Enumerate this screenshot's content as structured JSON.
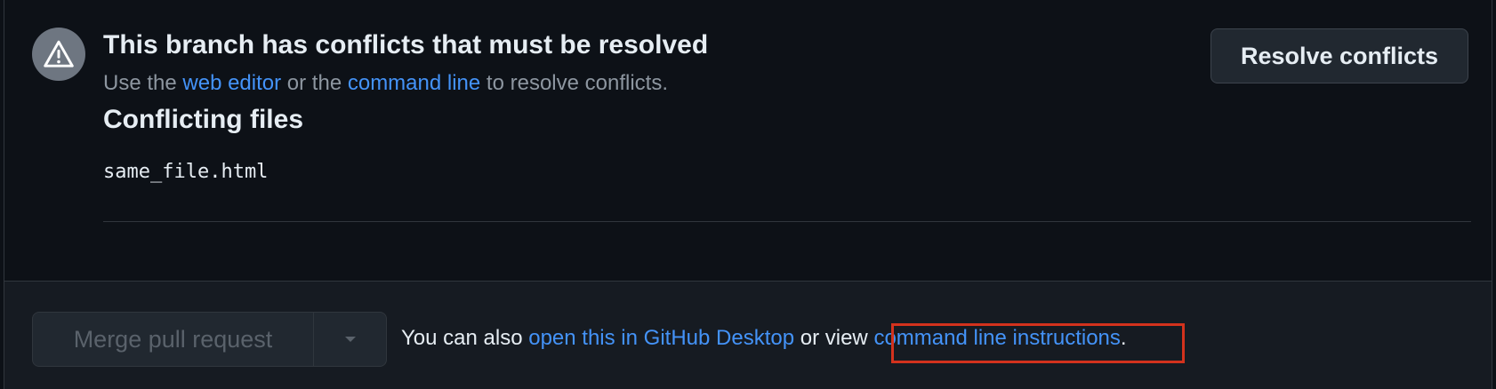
{
  "conflict_alert": {
    "icon": "alert-icon",
    "title": "This branch has conflicts that must be resolved",
    "desc_prefix": "Use the",
    "web_editor_link": "web editor",
    "desc_middle": "or the",
    "command_line_link": "command line",
    "desc_suffix": "to resolve conflicts.",
    "resolve_button_label": "Resolve conflicts"
  },
  "conflicting_files": {
    "heading": "Conflicting files",
    "files": [
      "same_file.html"
    ]
  },
  "merge": {
    "button_label": "Merge pull request",
    "dropdown_icon": "caret-down-icon",
    "text_prefix": "You can also",
    "desktop_link": "open this in GitHub Desktop",
    "text_middle": "or view",
    "instructions_link": "command line instructions",
    "text_suffix": "."
  },
  "colors": {
    "background": "#0d1117",
    "link": "#4493f8",
    "highlight": "#d3321d"
  }
}
